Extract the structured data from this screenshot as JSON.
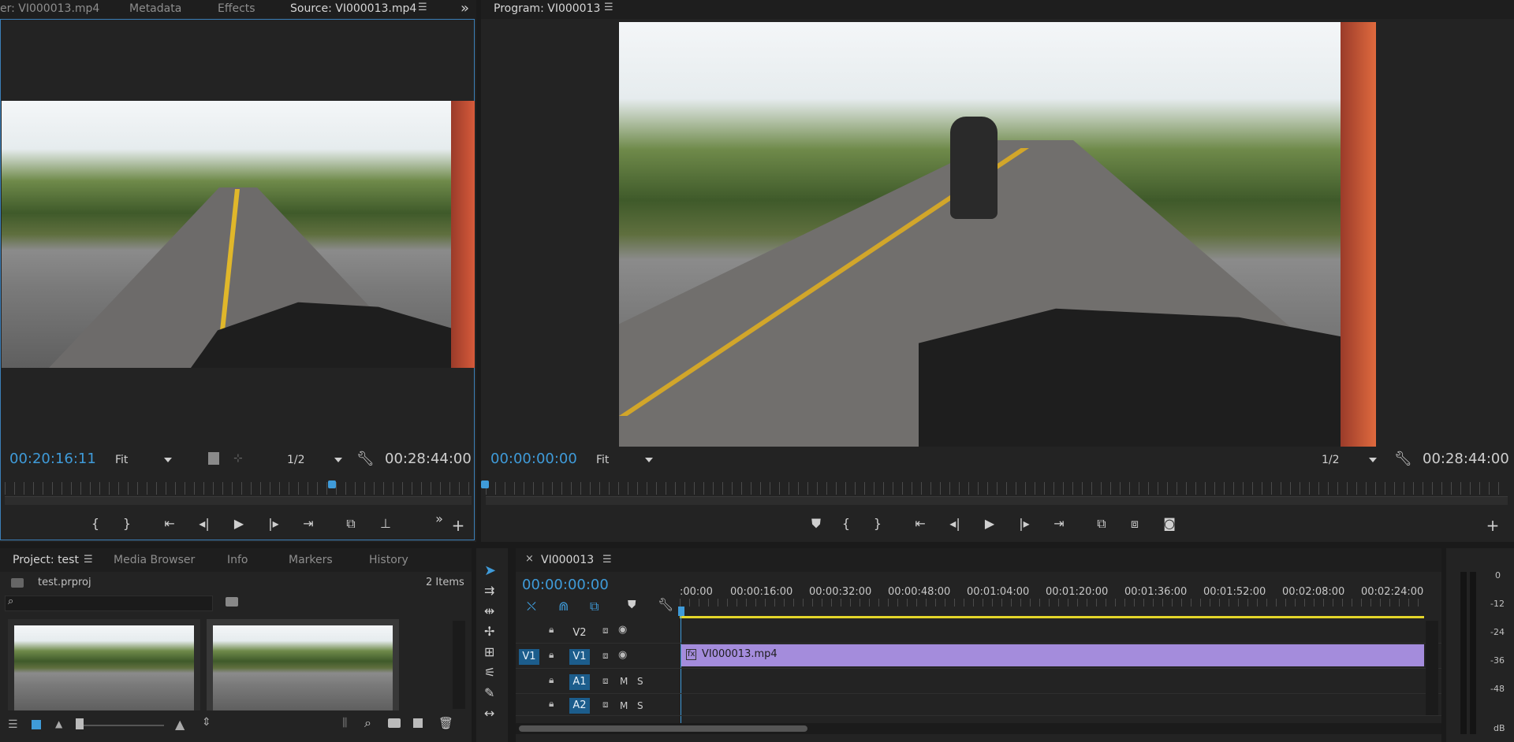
{
  "source_monitor": {
    "tabs": [
      "er: VI000013.mp4",
      "Metadata",
      "Effects",
      "Source: VI000013.mp4"
    ],
    "overflow_glyph": "»",
    "current_time": "00:20:16:11",
    "zoom_select": "Fit",
    "resolution_select": "1/2",
    "duration": "00:28:44:00"
  },
  "program_monitor": {
    "title": "Program: VI000013",
    "current_time": "00:00:00:00",
    "zoom_select": "Fit",
    "resolution_select": "1/2",
    "duration": "00:28:44:00"
  },
  "project_panel": {
    "tabs": [
      "Project: test",
      "Media Browser",
      "Info",
      "Markers",
      "History"
    ],
    "project_file": "test.prproj",
    "items_count": "2 Items",
    "search_placeholder": ""
  },
  "timeline": {
    "sequence_name": "VI000013",
    "current_time": "00:00:00:00",
    "ruler_times": [
      ":00:00",
      "00:00:16:00",
      "00:00:32:00",
      "00:00:48:00",
      "00:01:04:00",
      "00:01:20:00",
      "00:01:36:00",
      "00:01:52:00",
      "00:02:08:00",
      "00:02:24:00"
    ],
    "tracks": {
      "v2": "V2",
      "v1_source": "V1",
      "v1": "V1",
      "a1": "A1",
      "a2": "A2",
      "mute": "M",
      "solo": "S"
    },
    "clip_name": "VI000013.mp4",
    "clip_fx_glyph": "fx"
  },
  "audio_meter": {
    "scale": [
      "0",
      "-12",
      "-24",
      "-36",
      "-48",
      "dB"
    ]
  },
  "colors": {
    "accent_blue": "#3f9bd9",
    "track_blue": "#1c5d8c",
    "clip_purple": "#a48cdc",
    "work_area_yellow": "#e3d52a"
  },
  "icons": [
    "menu-icon",
    "wrench-icon",
    "play-icon",
    "step-back-icon",
    "step-forward-icon",
    "go-to-in-icon",
    "go-to-out-icon",
    "mark-in-icon",
    "mark-out-icon",
    "insert-icon",
    "overwrite-icon",
    "lift-icon",
    "extract-icon",
    "camera-icon",
    "add-icon",
    "lock-icon",
    "eye-icon",
    "selection-tool-icon",
    "razor-icon",
    "search-icon",
    "trash-icon",
    "folder-icon"
  ]
}
